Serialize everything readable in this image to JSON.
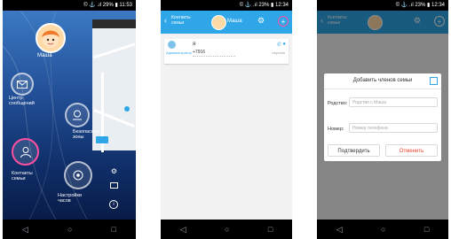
{
  "status_bar_1": "© ⚓ .ıl 29% ▮ 11:53",
  "status_bar_2": "© ⚓ .ıl 23% ▮ 12:34",
  "status_bar_3": "© ⚓ .ıl 23% ▮ 12:34",
  "screen1": {
    "profile_name": "Маша",
    "menu": {
      "messages": "Центр сообщений",
      "safe_zones": "Безопасные зоны",
      "family_contacts": "Контакты семьи",
      "watch_settings": "Настройки часов"
    }
  },
  "screen2": {
    "back_label": "Контакты семьи",
    "profile_name": "Маша",
    "contact": {
      "role": "Администратор",
      "name": "я",
      "phone": "+7916",
      "side_text": "неустан"
    }
  },
  "screen3": {
    "back_label": "Контакты семьи",
    "dialog": {
      "title": "Добавить членов семьи",
      "relation_label": "Родство:",
      "relation_placeholder": "Родство с Маша",
      "number_label": "Номер:",
      "number_placeholder": "Номер телефона",
      "confirm": "Подтвердить",
      "cancel": "Отменить"
    }
  },
  "nav_icons": [
    "back-icon",
    "home-icon",
    "recent-apps-icon"
  ],
  "colors": {
    "titlebar": "#2fa6e7",
    "accent_pink": "#ff4fa0",
    "cancel_red": "#e8412c"
  }
}
